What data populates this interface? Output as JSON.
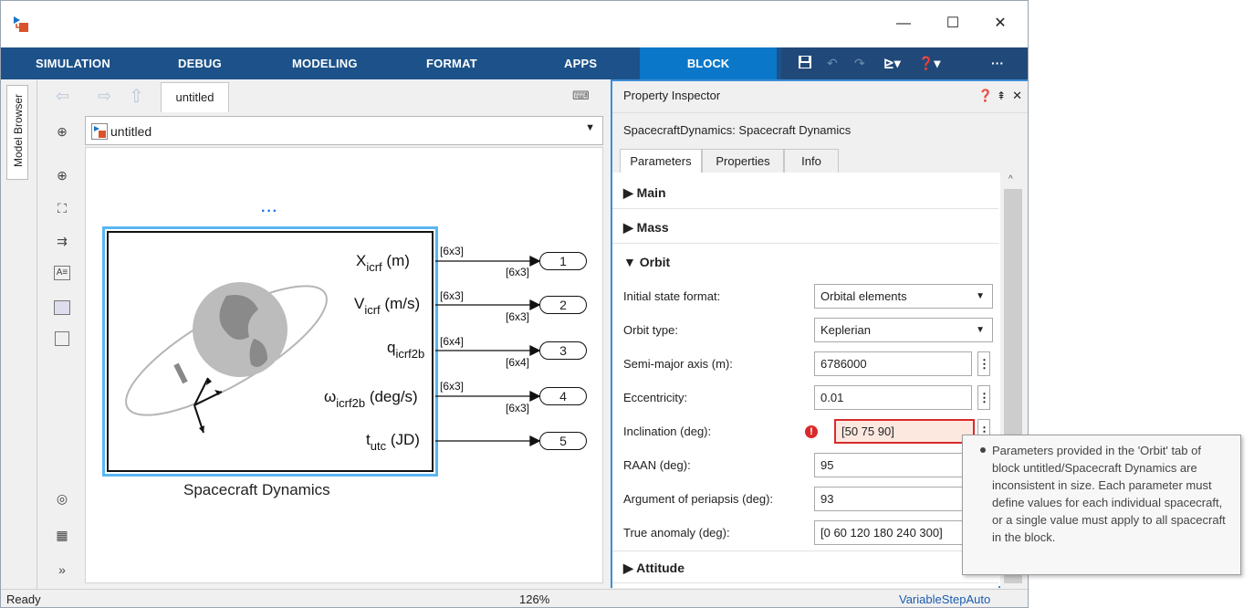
{
  "window": {
    "title_icon": "simulink-model-icon",
    "controls": {
      "minimize": "—",
      "maximize": "☐",
      "close": "✕"
    }
  },
  "ribbon": {
    "tabs": [
      "SIMULATION",
      "DEBUG",
      "MODELING",
      "FORMAT",
      "APPS",
      "BLOCK"
    ],
    "active_tab": "BLOCK",
    "quick_access": [
      "save-icon",
      "undo-icon",
      "redo-icon",
      "model-settings-icon",
      "help-icon",
      "more-icon"
    ],
    "more_label": "···"
  },
  "model_browser": {
    "label": "Model Browser"
  },
  "editor": {
    "tab_label": "untitled",
    "address": "untitled",
    "zoom": "126%"
  },
  "diagram": {
    "block_name": "Spacecraft Dynamics",
    "ellipsis": "···",
    "ports": [
      {
        "label": "X",
        "sub": "icrf",
        "unit": "(m)",
        "sig_out": "[6x3]",
        "sig_in": "[6x3]",
        "port": "1"
      },
      {
        "label": "V",
        "sub": "icrf",
        "unit": "(m/s)",
        "sig_out": "[6x3]",
        "sig_in": "[6x3]",
        "port": "2"
      },
      {
        "label": "q",
        "sub": "icrf2b",
        "unit": "",
        "sig_out": "[6x4]",
        "sig_in": "[6x4]",
        "port": "3"
      },
      {
        "label": "ω",
        "sub": "icrf2b",
        "unit": "(deg/s)",
        "sig_out": "[6x3]",
        "sig_in": "[6x3]",
        "port": "4"
      },
      {
        "label": "t",
        "sub": "utc",
        "unit": "(JD)",
        "sig_out": "",
        "sig_in": "",
        "port": "5"
      }
    ]
  },
  "property_inspector": {
    "title": "Property Inspector",
    "block": "SpacecraftDynamics: Spacecraft Dynamics",
    "tabs": [
      "Parameters",
      "Properties",
      "Info"
    ],
    "active_tab": "Parameters",
    "sections": {
      "main": "Main",
      "mass": "Mass",
      "orbit": "Orbit",
      "attitude": "Attitude"
    },
    "fields": [
      {
        "label": "Initial state format:",
        "value": "Orbital elements",
        "type": "dropdown"
      },
      {
        "label": "Orbit type:",
        "value": "Keplerian",
        "type": "dropdown"
      },
      {
        "label": "Semi-major axis (m):",
        "value": "6786000",
        "type": "text"
      },
      {
        "label": "Eccentricity:",
        "value": "0.01",
        "type": "text"
      },
      {
        "label": "Inclination (deg):",
        "value": "[50 75 90]",
        "type": "text",
        "error": true
      },
      {
        "label": "RAAN (deg):",
        "value": "95",
        "type": "text"
      },
      {
        "label": "Argument of periapsis (deg):",
        "value": "93",
        "type": "text"
      },
      {
        "label": "True anomaly (deg):",
        "value": "[0 60 120 180 240 300]",
        "type": "text"
      }
    ]
  },
  "tooltip": {
    "text": "Parameters provided in the 'Orbit' tab of block untitled/Spacecraft Dynamics are inconsistent in size. Each parameter must define values for each individual spacecraft, or a single value must apply to all spacecraft in the block."
  },
  "status": {
    "left": "Ready",
    "zoom": "126%",
    "solver": "VariableStepAuto"
  },
  "colors": {
    "ribbon": "#1c5289",
    "active_tab": "#0b77c9",
    "selection": "#5ab6f0",
    "error": "#d92b2b"
  }
}
